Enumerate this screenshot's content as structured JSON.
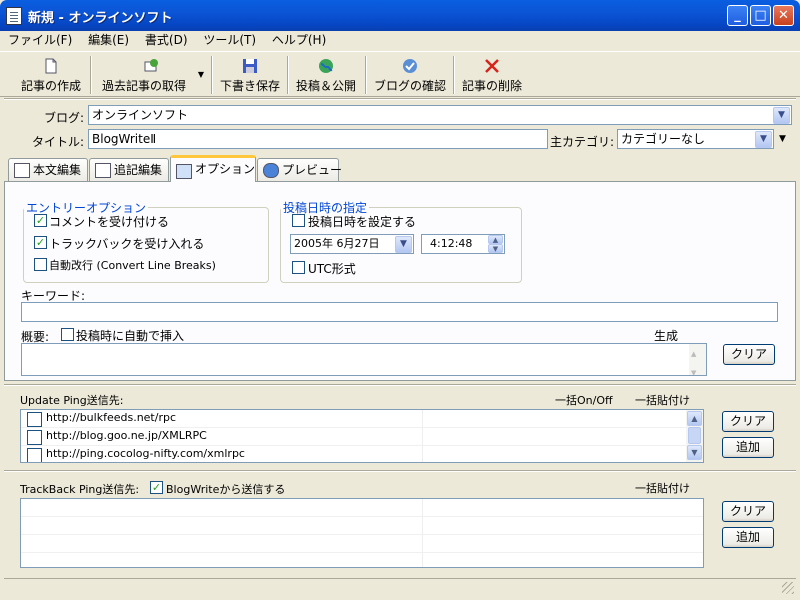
{
  "window": {
    "title": "新規 - オンラインソフト"
  },
  "menu": [
    "ファイル(F)",
    "編集(E)",
    "書式(D)",
    "ツール(T)",
    "ヘルプ(H)"
  ],
  "toolbar": {
    "create": "記事の作成",
    "fetch": "過去記事の取得",
    "save_draft": "下書き保存",
    "publish": "投稿＆公開",
    "check_blog": "ブログの確認",
    "delete": "記事の削除"
  },
  "header": {
    "blog_label": "ブログ:",
    "blog_value": "オンラインソフト",
    "title_label": "タイトル:",
    "title_value": "BlogWriteⅡ",
    "category_label": "主カテゴリ:",
    "category_value": "カテゴリーなし"
  },
  "tabs": [
    {
      "label": "本文編集",
      "icon": "edit-icon"
    },
    {
      "label": "追記編集",
      "icon": "document-icon"
    },
    {
      "label": "オプション",
      "icon": "options-icon",
      "active": true
    },
    {
      "label": "プレビュー",
      "icon": "browser-icon"
    }
  ],
  "options": {
    "entry_legend": "エントリーオプション",
    "allow_comments": {
      "label": "コメントを受け付ける",
      "checked": true
    },
    "allow_trackbacks": {
      "label": "トラックバックを受け入れる",
      "checked": true
    },
    "convert_line_breaks": {
      "label": "自動改行 (Convert Line Breaks)",
      "checked": false
    },
    "datetime_legend": "投稿日時の指定",
    "set_datetime": {
      "label": "投稿日時を設定する",
      "checked": false
    },
    "date_value": "2005年  6月27日",
    "time_value": "4:12:48",
    "utc": {
      "label": "UTC形式",
      "checked": false
    },
    "keyword_label": "キーワード:",
    "keyword_value": "",
    "summary_label": "概要:",
    "summary_auto": {
      "label": "投稿時に自動で挿入",
      "checked": false
    },
    "generate_label": "生成",
    "clear_label": "クリア"
  },
  "ping": {
    "title": "Update Ping送信先:",
    "toggle_all": "一括On/Off",
    "paste_all": "一括貼付け",
    "items": [
      "http://bulkfeeds.net/rpc",
      "http://blog.goo.ne.jp/XMLRPC",
      "http://ping.cocolog-nifty.com/xmlrpc"
    ],
    "clear_label": "クリア",
    "add_label": "追加"
  },
  "trackback": {
    "title": "TrackBack Ping送信先:",
    "send_from": {
      "label": "BlogWriteから送信する",
      "checked": true
    },
    "paste_all": "一括貼付け",
    "clear_label": "クリア",
    "add_label": "追加"
  }
}
